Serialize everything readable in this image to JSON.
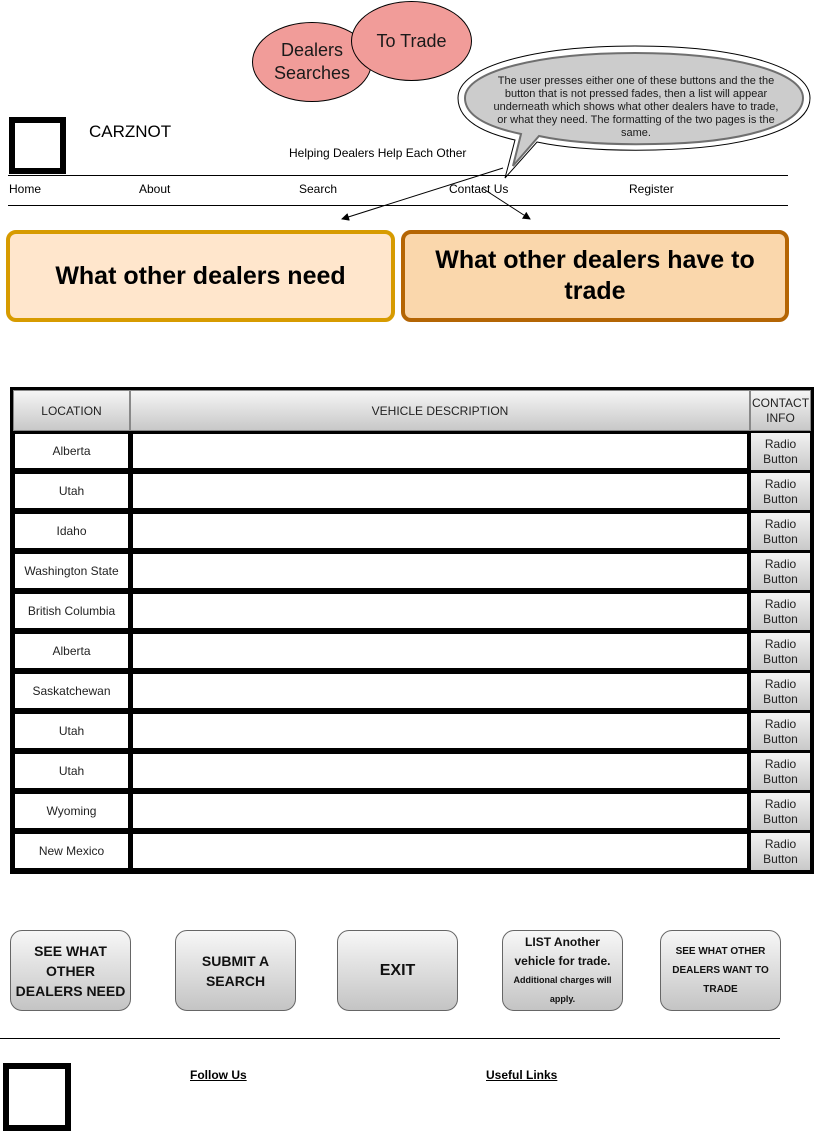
{
  "annotations": {
    "dealers_searches": "Dealers Searches",
    "to_trade": "To Trade",
    "callout": "The user presses either one of these buttons and the the button that is not pressed fades, then a list will appear underneath which shows what other dealers have to trade, or what they need. The formatting of the two pages is the same."
  },
  "header": {
    "brand": "CARZNOT",
    "tagline": "Helping Dealers Help Each Other"
  },
  "nav": [
    "Home",
    "About",
    "Search",
    "Contact Us",
    "Register"
  ],
  "toggle": {
    "need": "What other dealers need",
    "trade": "What other dealers have to trade"
  },
  "table": {
    "headers": [
      "LOCATION",
      "VEHICLE DESCRIPTION",
      "CONTACT INFO"
    ],
    "radio_label": "Radio Button",
    "rows": [
      {
        "location": "Alberta"
      },
      {
        "location": "Utah"
      },
      {
        "location": "Idaho"
      },
      {
        "location": "Washington State"
      },
      {
        "location": "British Columbia"
      },
      {
        "location": "Alberta"
      },
      {
        "location": "Saskatchewan"
      },
      {
        "location": "Utah"
      },
      {
        "location": "Utah"
      },
      {
        "location": "Wyoming"
      },
      {
        "location": "New Mexico"
      }
    ]
  },
  "actions": {
    "see_need": "SEE WHAT OTHER DEALERS NEED",
    "submit": "SUBMIT A SEARCH",
    "exit": "EXIT",
    "list_main": "LIST Another vehicle for trade.",
    "list_note": "Additional charges will apply.",
    "see_trade": "SEE WHAT OTHER DEALERS WANT TO TRADE"
  },
  "footer": {
    "follow": "Follow Us",
    "links": "Useful Links"
  },
  "colors": {
    "annotation_pink": "#f19c99",
    "need_fill": "#ffe6cc",
    "need_border": "#d79b00",
    "trade_fill": "#fad7ac",
    "trade_border": "#b46504",
    "callout_fill": "#cccccc"
  }
}
